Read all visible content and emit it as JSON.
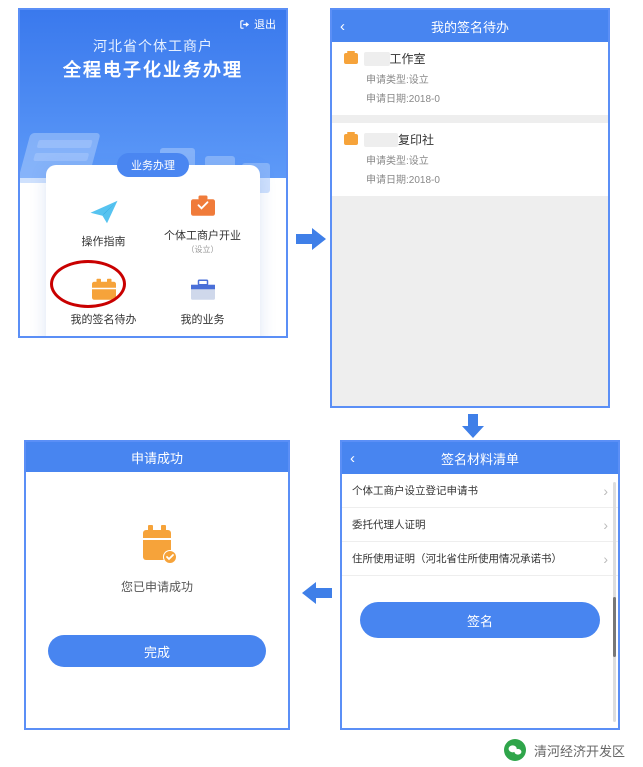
{
  "screen1": {
    "logout_label": "退出",
    "title_line1": "河北省个体工商户",
    "title_line2": "全程电子化业务办理",
    "tab_label": "业务办理",
    "cells": [
      {
        "label": "操作指南",
        "sub": ""
      },
      {
        "label": "个体工商户开业",
        "sub": "（设立）"
      },
      {
        "label": "我的签名待办",
        "sub": ""
      },
      {
        "label": "我的业务",
        "sub": ""
      }
    ]
  },
  "screen2": {
    "title": "我的签名待办",
    "items": [
      {
        "name_suffix": "工作室",
        "type_label": "申请类型:设立",
        "date_label": "申请日期:2018-0"
      },
      {
        "name_suffix": "复印社",
        "type_label": "申请类型:设立",
        "date_label": "申请日期:2018-0"
      }
    ]
  },
  "screen3": {
    "title": "签名材料清单",
    "rows": [
      "个体工商户设立登记申请书",
      "委托代理人证明",
      "住所使用证明（河北省住所使用情况承诺书）"
    ],
    "button_label": "签名"
  },
  "screen4": {
    "title": "申请成功",
    "message": "您已申请成功",
    "button_label": "完成"
  },
  "footer": {
    "account_name": "清河经济开发区"
  },
  "colors": {
    "primary": "#4885f0",
    "accent": "#f6a33a"
  }
}
